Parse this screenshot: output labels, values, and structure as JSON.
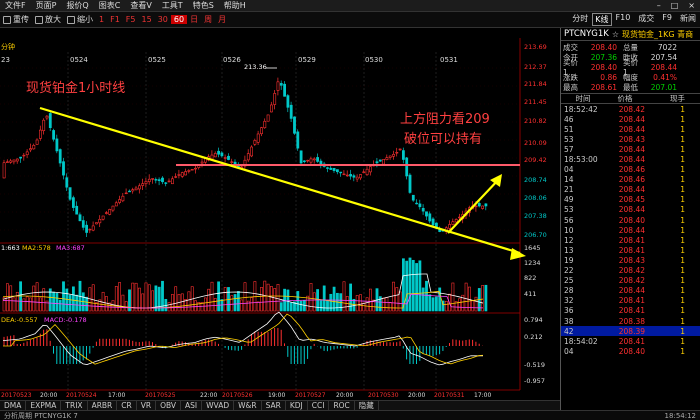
{
  "menu": [
    "文件F",
    "页面P",
    "报价Q",
    "图表C",
    "查看V",
    "工具T",
    "特色S",
    "帮助H"
  ],
  "toolbar": {
    "left": [
      "重传",
      "放大",
      "缩小"
    ],
    "periods": [
      "1",
      "F1",
      "F5",
      "15",
      "30",
      "60",
      "日",
      "周",
      "月"
    ],
    "active_period": "60",
    "right": [
      "分时",
      "K线",
      "F10",
      "成交",
      "F9",
      "新闻"
    ]
  },
  "chart": {
    "period_label": "分钟",
    "date_labels": [
      "23",
      "0524",
      "0525",
      "0526",
      "0529",
      "0530",
      "0531"
    ],
    "price_axis": [
      "213.69",
      "212.37",
      "211.84",
      "211.45",
      "210.82",
      "210.09",
      "209.42",
      "208.74",
      "208.06",
      "207.38",
      "206.70"
    ],
    "high_marker": "213.36",
    "vol_header": {
      "ma1": "1:663",
      "ma2": "MA2:578",
      "ma3": "MA3:687"
    },
    "vol_axis": [
      "1645",
      "1234",
      "822",
      "411"
    ],
    "macd_header": {
      "dea": "DEA:-0.557",
      "macd": "MACD:-0.178"
    },
    "macd_axis": [
      "0.794",
      "0.212",
      "-0.519",
      "-0.957"
    ],
    "time_axis": [
      "20170523",
      "20:00",
      "20170524",
      "17:00",
      "20170525",
      "22:00",
      "20170526",
      "19:00",
      "20170527",
      "20:00",
      "20170530",
      "20:00",
      "20170531",
      "17:00"
    ],
    "annotations": {
      "title": "现货铂金1小时线",
      "resist_line1": "上方阻力看209",
      "resist_line2": "破位可以持有"
    }
  },
  "indicator_tabs": [
    "DMA",
    "EXPMA",
    "TRIX",
    "ARBR",
    "CR",
    "VR",
    "OBV",
    "ASI",
    "WVAD",
    "W&R",
    "SAR",
    "KDJ",
    "CCI",
    "ROC",
    "隐藏"
  ],
  "quote": {
    "code": "PTCNYG1K",
    "name": "现货铂金_1KG 青商",
    "rows": [
      [
        {
          "l": "成交",
          "v": "208.40",
          "c": "up"
        },
        {
          "l": "总量",
          "v": "7022",
          "c": "wh"
        }
      ],
      [
        {
          "l": "今开",
          "v": "207.36",
          "c": "dn"
        },
        {
          "l": "昨收",
          "v": "207.54",
          "c": "wh"
        }
      ],
      [
        {
          "l": "买价1",
          "v": "208.40",
          "c": "up"
        },
        {
          "l": "卖价1",
          "v": "208.44",
          "c": "up"
        }
      ],
      [
        {
          "l": "涨跌",
          "v": "0.86",
          "c": "up"
        },
        {
          "l": "幅度",
          "v": "0.41%",
          "c": "up"
        }
      ],
      [
        {
          "l": "最高",
          "v": "208.61",
          "c": "up"
        },
        {
          "l": "最低",
          "v": "207.01",
          "c": "dn"
        }
      ]
    ],
    "ticks_header": [
      "时间",
      "价格",
      "现手"
    ],
    "ticks": [
      {
        "t": "18:52:42",
        "p": "208.42",
        "q": "1"
      },
      {
        "t": "46",
        "p": "208.44",
        "q": "1"
      },
      {
        "t": "51",
        "p": "208.44",
        "q": "1"
      },
      {
        "t": "53",
        "p": "208.43",
        "q": "1"
      },
      {
        "t": "57",
        "p": "208.44",
        "q": "1"
      },
      {
        "t": "18:53:00",
        "p": "208.44",
        "q": "1"
      },
      {
        "t": "04",
        "p": "208.46",
        "q": "1"
      },
      {
        "t": "14",
        "p": "208.46",
        "q": "1"
      },
      {
        "t": "21",
        "p": "208.44",
        "q": "1"
      },
      {
        "t": "49",
        "p": "208.45",
        "q": "1"
      },
      {
        "t": "53",
        "p": "208.44",
        "q": "1"
      },
      {
        "t": "56",
        "p": "208.40",
        "q": "1"
      },
      {
        "t": "10",
        "p": "208.44",
        "q": "1"
      },
      {
        "t": "12",
        "p": "208.41",
        "q": "1"
      },
      {
        "t": "13",
        "p": "208.41",
        "q": "1"
      },
      {
        "t": "19",
        "p": "208.43",
        "q": "1"
      },
      {
        "t": "22",
        "p": "208.42",
        "q": "1"
      },
      {
        "t": "25",
        "p": "208.42",
        "q": "1"
      },
      {
        "t": "28",
        "p": "208.44",
        "q": "1"
      },
      {
        "t": "32",
        "p": "208.41",
        "q": "1"
      },
      {
        "t": "36",
        "p": "208.41",
        "q": "1"
      },
      {
        "t": "38",
        "p": "208.38",
        "q": "1"
      },
      {
        "t": "42",
        "p": "208.39",
        "q": "1",
        "sel": true
      },
      {
        "t": "18:54:02",
        "p": "208.41",
        "q": "1"
      },
      {
        "t": "04",
        "p": "208.40",
        "q": "1"
      }
    ]
  },
  "status": {
    "left": "分析周期 PTCNYG1K 7",
    "right": "18:54:12"
  },
  "colors": {
    "up": "#ff3030",
    "down": "#00c8c8",
    "yellow": "#ffff00",
    "ma_white": "#ffffff",
    "ma_yellow": "#ffd000",
    "ma_purple": "#ff44ff",
    "resist": "#ff5a6a"
  }
}
